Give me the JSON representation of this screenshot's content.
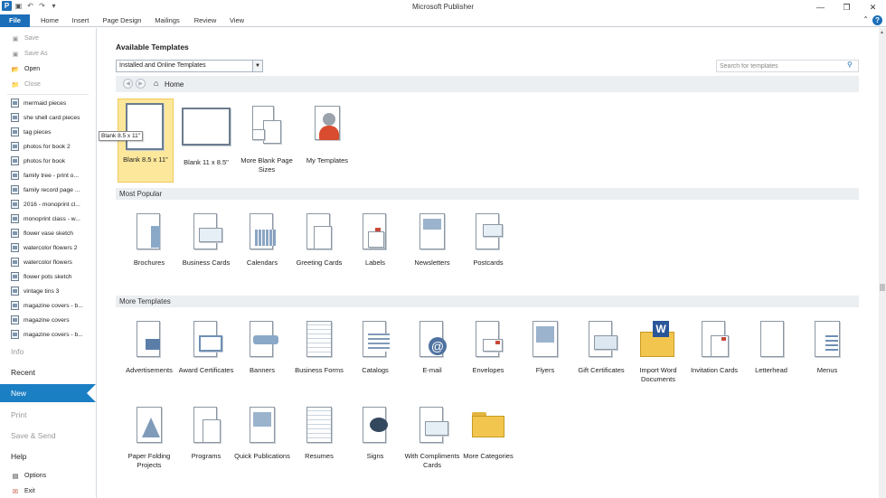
{
  "app": {
    "title": "Microsoft Publisher"
  },
  "ribbon": {
    "tabs": [
      "File",
      "Home",
      "Insert",
      "Page Design",
      "Mailings",
      "Review",
      "View"
    ]
  },
  "sidebar": {
    "commands": [
      {
        "label": "Save",
        "icon": "save-icon",
        "disabled": true
      },
      {
        "label": "Save As",
        "icon": "save-as-icon",
        "disabled": true
      },
      {
        "label": "Open",
        "icon": "open-folder-icon",
        "disabled": false
      },
      {
        "label": "Close",
        "icon": "close-document-icon",
        "disabled": true
      }
    ],
    "recent": [
      "mermaid pieces",
      "she shell card pieces",
      "tag pieces",
      "photos for book 2",
      "photos for book",
      "family tree - print o...",
      "family record page ...",
      "2016 - monoprint cl...",
      "monoprint class - w...",
      "flower vase sketch",
      "watercolor flowers 2",
      "watercolor flowers",
      "flower pots sketch",
      "vintage tins 3",
      "magazine covers - b...",
      "magazine covers",
      "magazine covers - b..."
    ],
    "sections": {
      "info": "Info",
      "recent": "Recent",
      "new": "New",
      "print": "Print",
      "save_send": "Save & Send",
      "help": "Help",
      "options": "Options",
      "exit": "Exit"
    }
  },
  "main": {
    "heading": "Available Templates",
    "source_select": "Installed and Online Templates",
    "search_placeholder": "Search for templates",
    "breadcrumb": "Home",
    "tooltip": "Blank 8.5 x 11\"",
    "blank_templates": [
      {
        "label": "Blank 8.5 x 11\"",
        "selected": true
      },
      {
        "label": "Blank 11 x 8.5\"",
        "selected": false
      },
      {
        "label": "More Blank Page Sizes",
        "selected": false
      },
      {
        "label": "My Templates",
        "selected": false
      }
    ],
    "most_popular_title": "Most Popular",
    "most_popular": [
      "Brochures",
      "Business Cards",
      "Calendars",
      "Greeting Cards",
      "Labels",
      "Newsletters",
      "Postcards"
    ],
    "more_templates_title": "More Templates",
    "more_templates_row1": [
      "Advertisements",
      "Award Certificates",
      "Banners",
      "Business Forms",
      "Catalogs",
      "E-mail",
      "Envelopes",
      "Flyers",
      "Gift Certificates",
      "Import Word Documents",
      "Invitation Cards",
      "Letterhead",
      "Menus"
    ],
    "more_templates_row2": [
      "Paper Folding Projects",
      "Programs",
      "Quick Publications",
      "Resumes",
      "Signs",
      "With Compliments Cards",
      "More Categories"
    ]
  }
}
